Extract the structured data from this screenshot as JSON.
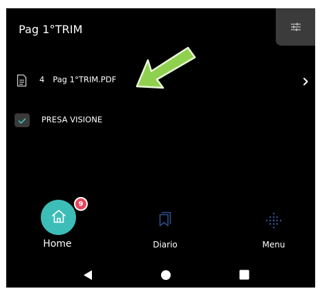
{
  "header": {
    "title": "Pag 1°TRIM",
    "filter_icon": "sliders-icon"
  },
  "file_item": {
    "count": "4",
    "name": "Pag 1°TRIM.PDF",
    "icon": "document-icon",
    "chevron_icon": "chevron-right-icon"
  },
  "annotation": {
    "arrow_icon": "green-arrow-icon",
    "color": "#8fd14f"
  },
  "checkbox_item": {
    "label": "PRESA VISIONE",
    "checked": true,
    "check_color": "#3dbdb7"
  },
  "bottom_nav": {
    "home": {
      "label": "Home",
      "badge": "9",
      "icon": "home-icon",
      "color": "#3dbdb7"
    },
    "diario": {
      "label": "Diario",
      "icon": "bookmarks-icon"
    },
    "menu": {
      "label": "Menu",
      "icon": "dots-grid-icon"
    }
  },
  "system_nav": {
    "back_icon": "back-triangle-icon",
    "home_icon": "home-circle-icon",
    "recents_icon": "recents-square-icon"
  }
}
